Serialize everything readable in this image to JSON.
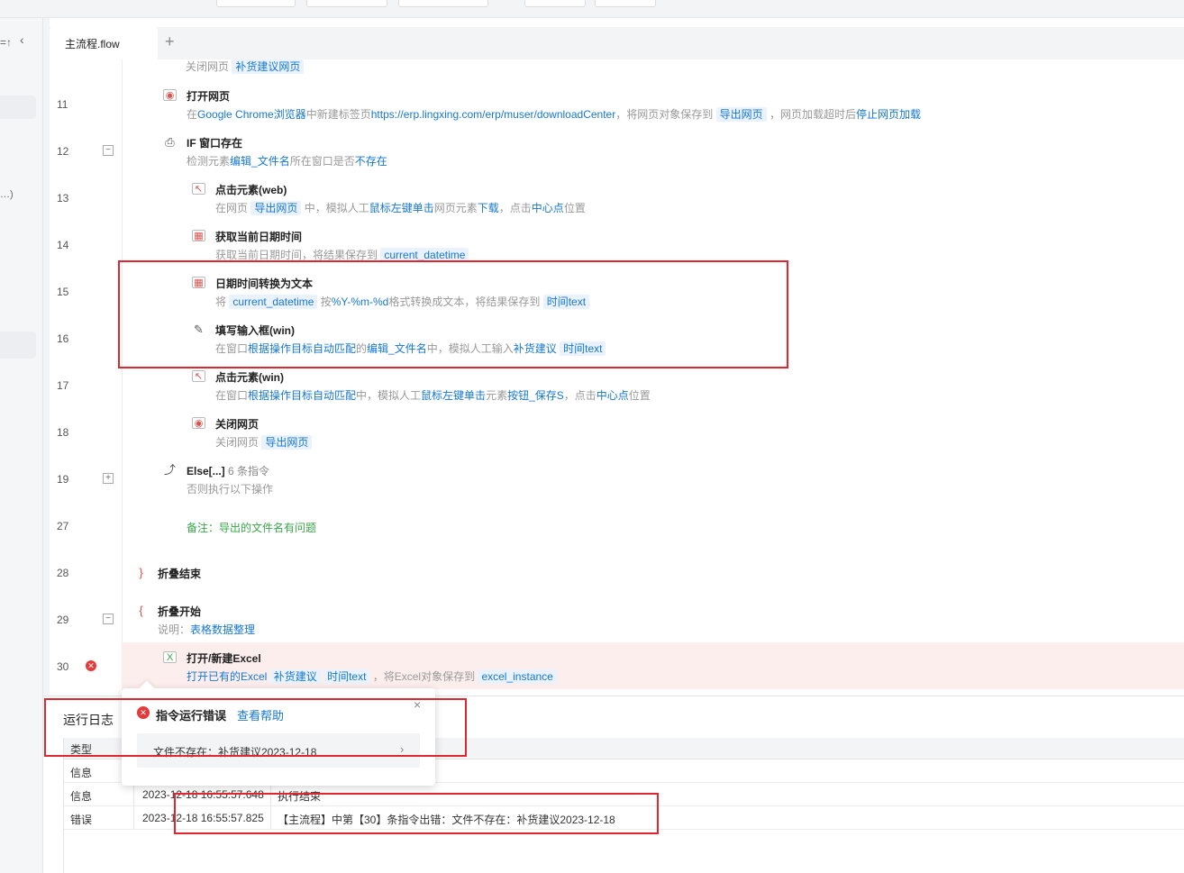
{
  "tab": {
    "label": "主流程.flow",
    "add": "+"
  },
  "sidebar": {
    "icons": "=↑",
    "collapse": "‹",
    "truncated": "…)"
  },
  "rows": {
    "r0": {
      "desc_prefix": "关闭网页",
      "chip": "补货建议网页"
    },
    "r11": {
      "ln": "11",
      "title": "打开网页",
      "d1": "在",
      "d2": "Google Chrome浏览器",
      "d3": "中新建标签页",
      "d4": "https://erp.lingxing.com/erp/muser/downloadCenter",
      "d5": "，将网页对象保存到",
      "d6": "导出网页",
      "d7": "，网页加载超时后",
      "d8": "停止网页加载"
    },
    "r12": {
      "ln": "12",
      "fold": "−",
      "title": "IF 窗口存在",
      "d1": "检测元素",
      "d2": "编辑_文件名",
      "d3": "所在窗口是否",
      "d4": "不存在"
    },
    "r13": {
      "ln": "13",
      "title": "点击元素(web)",
      "d1": "在网页",
      "d2": "导出网页",
      "d3": "中，模拟人工",
      "d4": "鼠标左键单击",
      "d5": "网页元素",
      "d6": "下载",
      "d7": "，点击",
      "d8": "中心点",
      "d9": "位置"
    },
    "r14": {
      "ln": "14",
      "title": "获取当前日期时间",
      "d1": "获取当前日期时间，将结果保存到",
      "d2": "current_datetime"
    },
    "r15": {
      "ln": "15",
      "title": "日期时间转换为文本",
      "d1": "将",
      "d2": "current_datetime",
      "d3": "按",
      "d4": "%Y-%m-%d",
      "d5": "格式转换成文本，将结果保存到",
      "d6": "时间text"
    },
    "r16": {
      "ln": "16",
      "title": "填写输入框(win)",
      "d1": "在窗口",
      "d2": "根据操作目标自动匹配",
      "d3": "的",
      "d4": "编辑_文件名",
      "d5": "中，模拟人工输入",
      "d6": "补货建议",
      "d7": "时间text"
    },
    "r17": {
      "ln": "17",
      "title": "点击元素(win)",
      "d1": "在窗口",
      "d2": "根据操作目标自动匹配",
      "d3": "中，模拟人工",
      "d4": "鼠标左键单击",
      "d5": "元素",
      "d6": "按钮_保存S",
      "d7": "，点击",
      "d8": "中心点",
      "d9": "位置"
    },
    "r18": {
      "ln": "18",
      "title": "关闭网页",
      "d1": "关闭网页",
      "d2": "导出网页"
    },
    "r19": {
      "ln": "19",
      "fold": "+",
      "title": "Else[...]",
      "count": "6 条指令",
      "d1": "否则执行以下操作"
    },
    "r27": {
      "ln": "27",
      "d1": "备注：导出的文件名有问题"
    },
    "r28": {
      "ln": "28",
      "title": "折叠结束"
    },
    "r29": {
      "ln": "29",
      "fold": "−",
      "title": "折叠开始",
      "d1": "说明：",
      "d2": "表格数据整理"
    },
    "r30": {
      "ln": "30",
      "title": "打开/新建Excel",
      "d1": "打开已有的Excel",
      "d2": "补货建议",
      "d3": "时间text",
      "d4": "，将Excel对象保存到",
      "d5": "excel_instance"
    }
  },
  "log": {
    "title": "运行日志",
    "col_type": "类型",
    "rows": [
      {
        "type": "信息",
        "time": "",
        "msg": ""
      },
      {
        "type": "信息",
        "time": "2023-12-18 16:55:57.648",
        "msg": "执行结束"
      },
      {
        "type": "错误",
        "time": "2023-12-18 16:55:57.825",
        "msg": "【主流程】中第【30】条指令出错：文件不存在：补货建议2023-12-18"
      }
    ]
  },
  "popup": {
    "title": "指令运行错误",
    "help": "查看帮助",
    "close": "×",
    "item": "文件不存在：补货建议2023-12-18",
    "item_arrow": "›"
  },
  "colors": {
    "accent": "#1677d2",
    "error": "#e33b3b",
    "annotation": "#e0262e",
    "error_row_bg": "#fdeeee"
  }
}
